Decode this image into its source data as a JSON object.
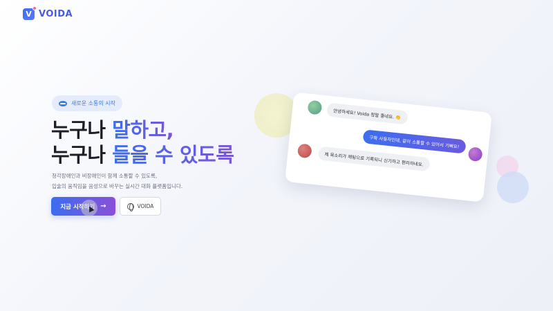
{
  "brand": {
    "logo_mark": "V",
    "name": "VOIDA"
  },
  "hero": {
    "badge": {
      "icon": "chat-bubble-icon",
      "label": "새로운 소통의 시작"
    },
    "headline": {
      "line1_plain": "누구나 ",
      "line1_accent": "말하고,",
      "line2_plain": "누구나 ",
      "line2_accent": "들을 수 있도록"
    },
    "description": [
      "청각장애인과 비장애인이 함께 소통할 수 있도록,",
      "입술의 움직임을 음성으로 바꾸는 실시간 대화 플랫폼입니다."
    ],
    "primary_button": {
      "label": "지금 시작하기",
      "icon": "arrow-right-icon"
    },
    "secondary_button": {
      "label": "VOIDA",
      "icon": "globe-icon"
    }
  },
  "chat_preview": {
    "messages": [
      {
        "text": "안녕하세요! Voida 정말 좋네요. 👏",
        "side": "left"
      },
      {
        "text": "구화 사용자인데, 같이 소통할 수 있어서 기뻐요!",
        "side": "right"
      },
      {
        "text": "제 목소리가 채팅으로 기록되니 신기하고 편리하네요.",
        "side": "left"
      }
    ]
  },
  "colors": {
    "accent_start": "#3b6ef0",
    "accent_end": "#8a4fd8",
    "badge_bg": "#e4ebfb",
    "text_dark": "#1d1f28"
  }
}
